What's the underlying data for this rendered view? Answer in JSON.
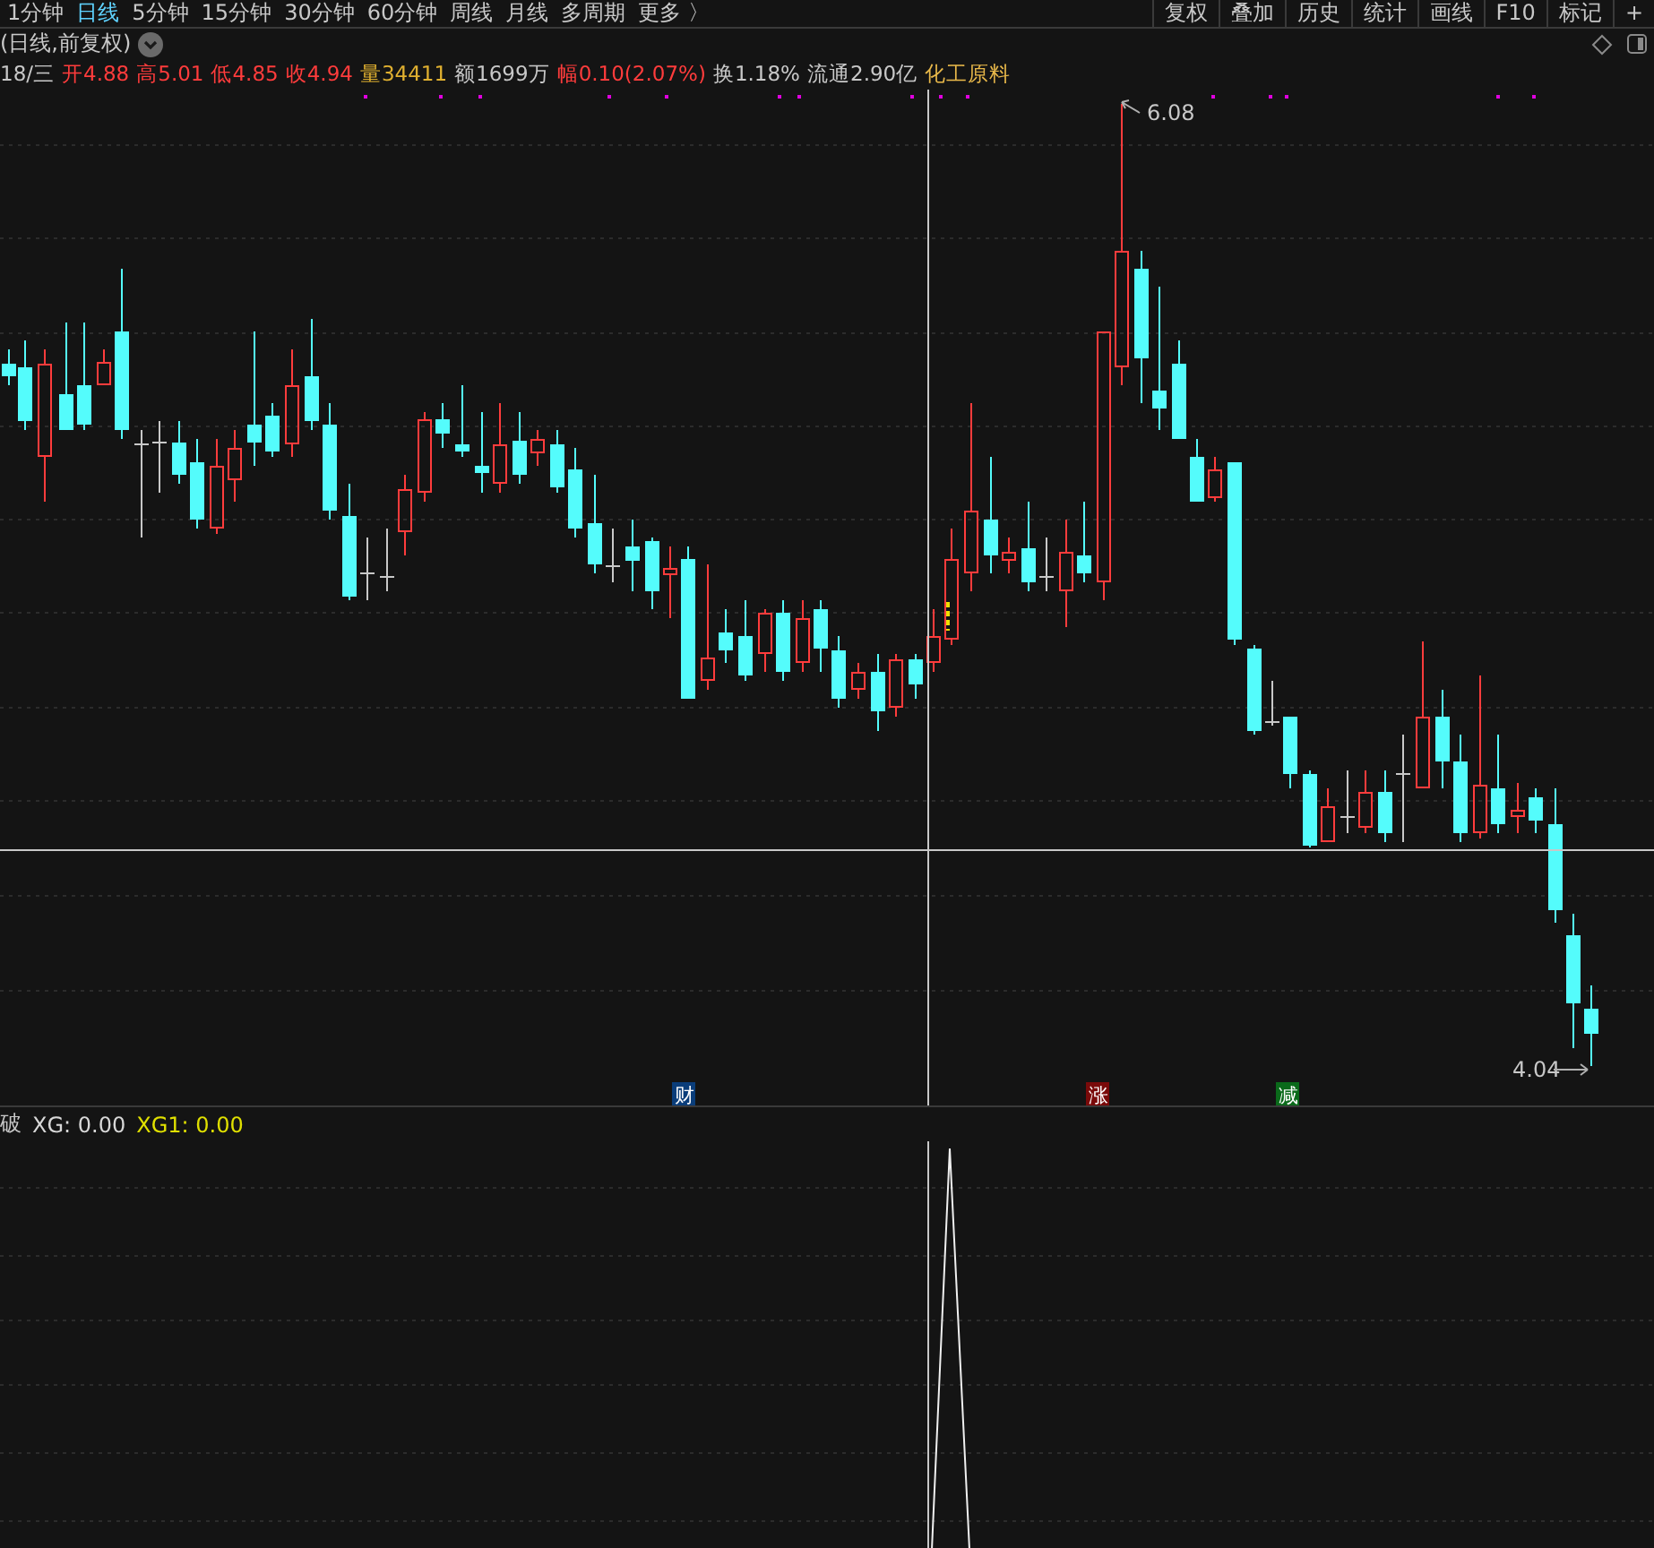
{
  "period_tabs": [
    {
      "label": "1分钟",
      "selected": false
    },
    {
      "label": "日线",
      "selected": true
    },
    {
      "label": "5分钟",
      "selected": false
    },
    {
      "label": "15分钟",
      "selected": false
    },
    {
      "label": "30分钟",
      "selected": false
    },
    {
      "label": "60分钟",
      "selected": false
    },
    {
      "label": "周线",
      "selected": false
    },
    {
      "label": "月线",
      "selected": false
    },
    {
      "label": "多周期",
      "selected": false
    },
    {
      "label": "更多 〉",
      "selected": false
    }
  ],
  "toolbar_buttons": [
    "复权",
    "叠加",
    "历史",
    "统计",
    "画线",
    "F10",
    "标记",
    "+"
  ],
  "chart_title": "(日线,前复权)",
  "quote": [
    {
      "text": "18/三",
      "kind": "date"
    },
    {
      "text": "开4.88",
      "kind": "up"
    },
    {
      "text": "高5.01",
      "kind": "up"
    },
    {
      "text": "低4.85",
      "kind": "up"
    },
    {
      "text": "收4.94",
      "kind": "up"
    },
    {
      "text": "量34411",
      "kind": "volume"
    },
    {
      "text": "额1699万",
      "kind": "neutral"
    },
    {
      "text": "幅0.10(2.07%)",
      "kind": "up"
    },
    {
      "text": "换1.18%",
      "kind": "neutral"
    },
    {
      "text": "流通2.90亿",
      "kind": "neutral"
    },
    {
      "text": "化工原料",
      "kind": "sector"
    }
  ],
  "price_labels": {
    "high": "6.08",
    "low": "4.04"
  },
  "event_markers": [
    {
      "label": "财",
      "kind": "finance"
    },
    {
      "label": "涨",
      "kind": "rise"
    },
    {
      "label": "减",
      "kind": "reduce"
    }
  ],
  "indicator": {
    "name": "破",
    "lines": [
      {
        "label": "XG: 0.00",
        "kind": "xg"
      },
      {
        "label": "XG1: 0.00",
        "kind": "xg1"
      }
    ]
  }
}
